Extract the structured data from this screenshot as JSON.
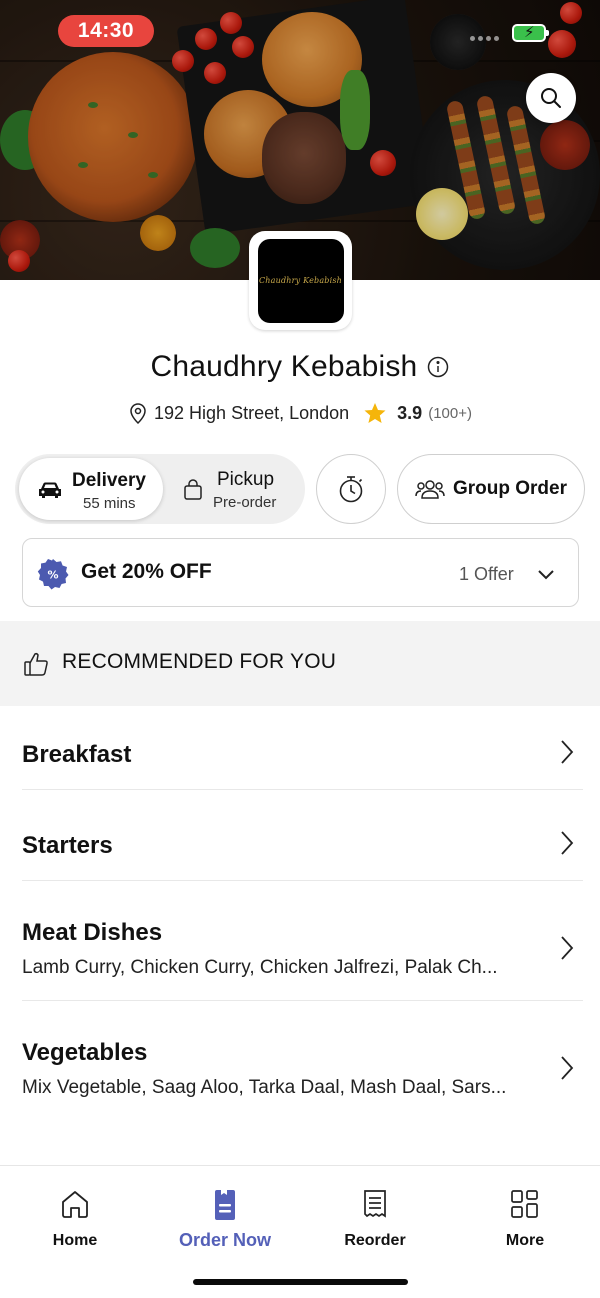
{
  "status_bar": {
    "time": "14:30"
  },
  "restaurant": {
    "logo_text": "Chaudhry Kebabish",
    "name": "Chaudhry Kebabish",
    "address": "192 High Street, London",
    "rating": "3.9",
    "rating_count": "(100+)"
  },
  "order_modes": {
    "delivery": {
      "label": "Delivery",
      "sub": "55 mins",
      "selected": true
    },
    "pickup": {
      "label": "Pickup",
      "sub": "Pre-order",
      "selected": false
    }
  },
  "group_order": {
    "label": "Group Order"
  },
  "offer": {
    "title": "Get 20% OFF",
    "count": "1 Offer"
  },
  "recommended": {
    "label": "RECOMMENDED FOR YOU"
  },
  "categories": [
    {
      "title": "Breakfast",
      "desc": ""
    },
    {
      "title": "Starters",
      "desc": ""
    },
    {
      "title": "Meat Dishes",
      "desc": "Lamb Curry, Chicken Curry, Chicken Jalfrezi, Palak Ch..."
    },
    {
      "title": "Vegetables",
      "desc": "Mix Vegetable, Saag Aloo, Tarka Daal, Mash Daal, Sars..."
    }
  ],
  "bottom_nav": [
    {
      "label": "Home",
      "icon": "home-icon",
      "active": false
    },
    {
      "label": "Order Now",
      "icon": "order-now-icon",
      "active": true
    },
    {
      "label": "Reorder",
      "icon": "receipt-icon",
      "active": false
    },
    {
      "label": "More",
      "icon": "grid-icon",
      "active": false
    }
  ],
  "colors": {
    "accent": "#5460b8",
    "star": "#f5b50a",
    "time_pill": "#e8453e",
    "battery": "#3ac04b",
    "offer_badge": "#4c5ab0"
  }
}
